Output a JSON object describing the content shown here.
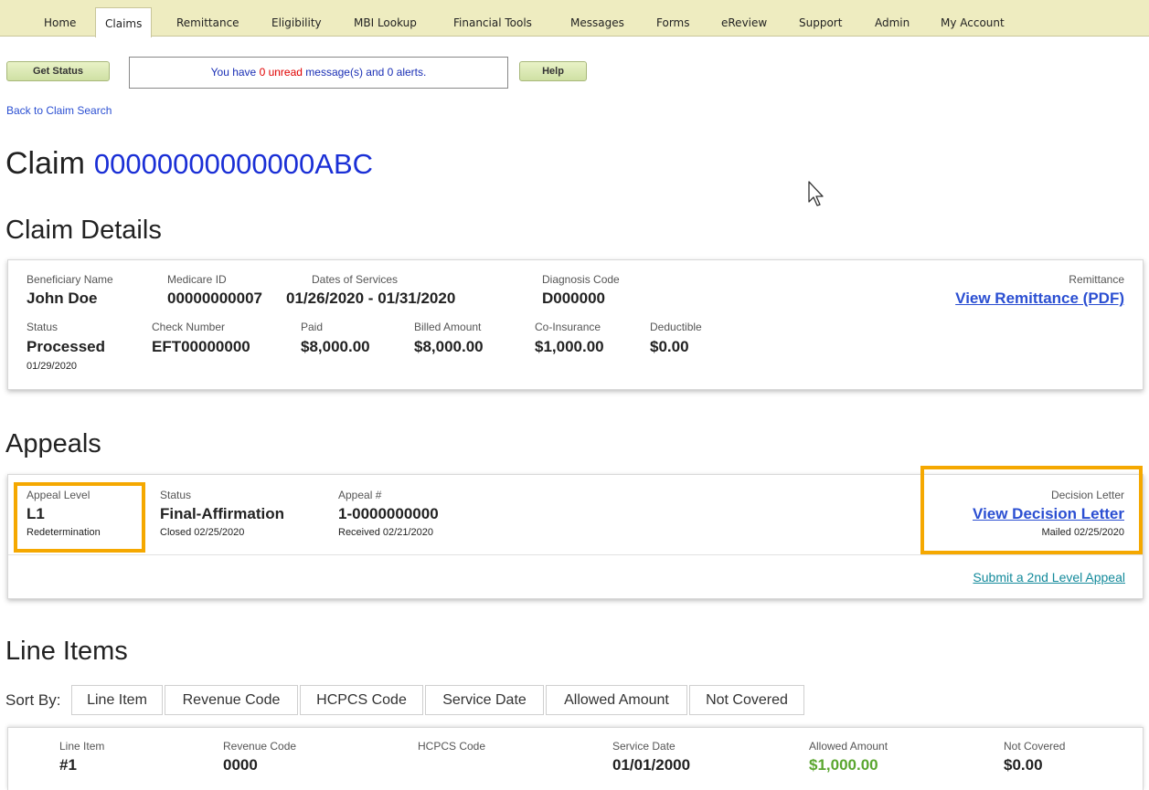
{
  "nav": {
    "tabs": [
      {
        "label": "Home"
      },
      {
        "label": "Claims"
      },
      {
        "label": "Remittance"
      },
      {
        "label": "Eligibility"
      },
      {
        "label": "MBI Lookup"
      },
      {
        "label": "Financial Tools"
      },
      {
        "label": "Messages"
      },
      {
        "label": "Forms"
      },
      {
        "label": "eReview"
      },
      {
        "label": "Support"
      },
      {
        "label": "Admin"
      },
      {
        "label": "My Account"
      }
    ],
    "active": "Claims"
  },
  "toolbar": {
    "get_status": "Get Status",
    "help": "Help",
    "message": {
      "prefix": "You have ",
      "unread": "0 unread",
      "suffix": " message(s) and 0 alerts."
    }
  },
  "back_link": "Back to Claim Search",
  "claim": {
    "heading": "Claim",
    "id": "00000000000000ABC"
  },
  "claim_details": {
    "title": "Claim Details",
    "beneficiary_label": "Beneficiary Name",
    "beneficiary": "John Doe",
    "medicare_label": "Medicare ID",
    "medicare": "00000000007",
    "dates_label": "Dates of Services",
    "dates": "01/26/2020 - 01/31/2020",
    "diag_label": "Diagnosis Code",
    "diag": "D000000",
    "remit_label": "Remittance",
    "remit_link": "View Remittance (PDF)",
    "status_label": "Status",
    "status": "Processed",
    "status_date": "01/29/2020",
    "check_label": "Check Number",
    "check": "EFT00000000",
    "paid_label": "Paid",
    "paid": "$8,000.00",
    "billed_label": "Billed Amount",
    "billed": "$8,000.00",
    "coins_label": "Co-Insurance",
    "coins": "$1,000.00",
    "deduct_label": "Deductible",
    "deduct": "$0.00"
  },
  "appeals": {
    "title": "Appeals",
    "level_label": "Appeal Level",
    "level": "L1",
    "level_sub": "Redetermination",
    "status_label": "Status",
    "status": "Final-Affirmation",
    "status_sub": "Closed 02/25/2020",
    "num_label": "Appeal #",
    "num": "1-0000000000",
    "num_sub": "Received 02/21/2020",
    "letter_label": "Decision Letter",
    "letter_link": "View Decision Letter",
    "letter_sub": "Mailed 02/25/2020",
    "submit_link": "Submit a 2nd Level Appeal",
    "highlight_color": "#f5a800"
  },
  "line_items": {
    "title": "Line Items",
    "sort_label": "Sort By:",
    "sort_buttons": [
      "Line Item",
      "Revenue Code",
      "HCPCS Code",
      "Service Date",
      "Allowed Amount",
      "Not Covered"
    ],
    "row": {
      "line_label": "Line Item",
      "line": "#1",
      "rev_label": "Revenue Code",
      "rev": "0000",
      "hcpcs_label": "HCPCS Code",
      "date_label": "Service Date",
      "date": "01/01/2000",
      "allowed_label": "Allowed Amount",
      "allowed": "$1,000.00",
      "notcov_label": "Not Covered",
      "notcov": "$0.00"
    }
  }
}
